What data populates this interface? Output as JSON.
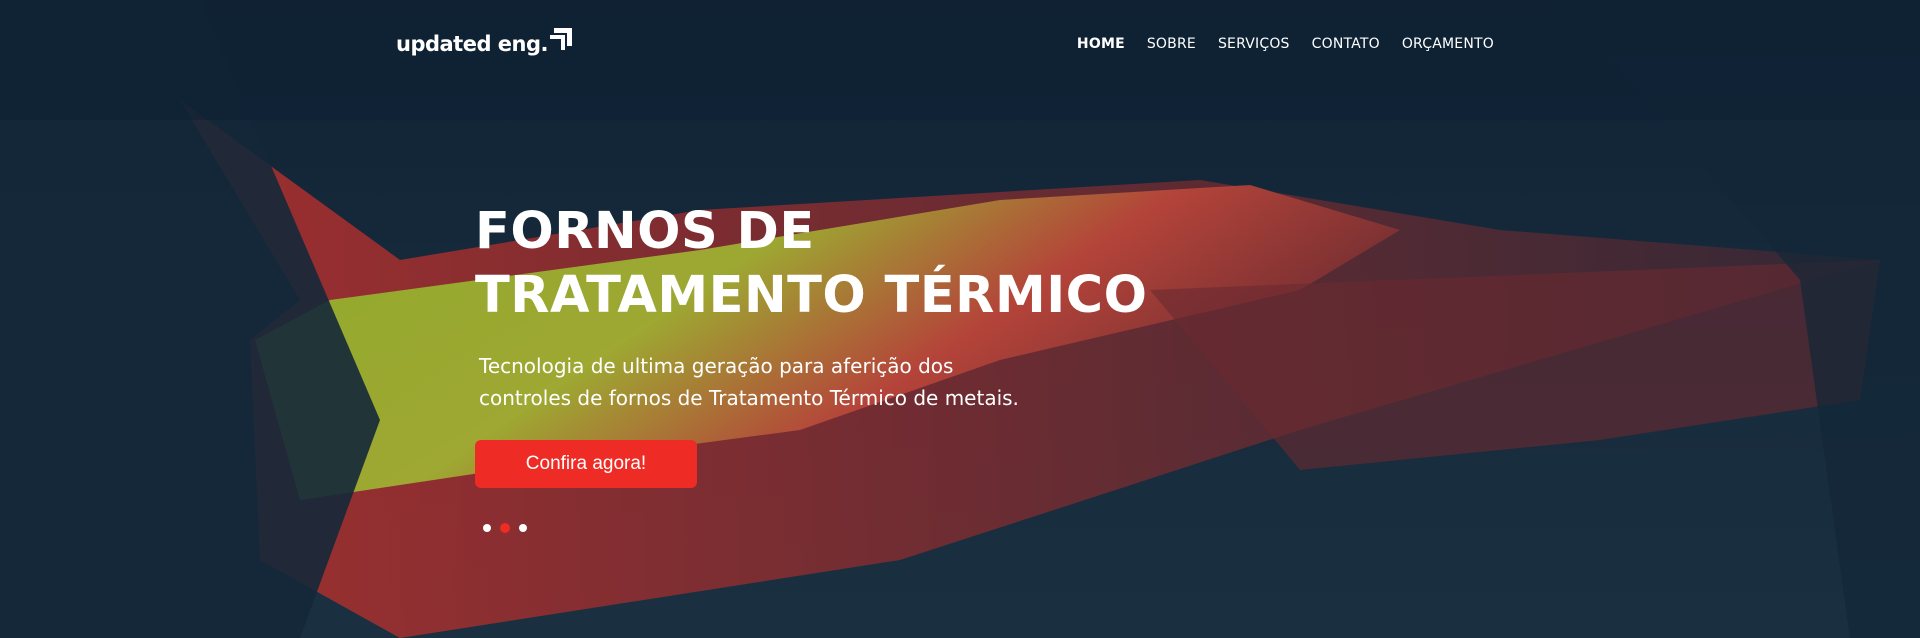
{
  "logo": {
    "text": "updated eng."
  },
  "nav": [
    {
      "label": "HOME",
      "active": true
    },
    {
      "label": "SOBRE"
    },
    {
      "label": "SERVIÇOS"
    },
    {
      "label": "CONTATO"
    },
    {
      "label": "ORÇAMENTO"
    }
  ],
  "hero": {
    "title_line1": "FORNOS DE",
    "title_line2": "TRATAMENTO TÉRMICO",
    "subtitle_line1": "Tecnologia de ultima geração para aferição dos",
    "subtitle_line2": "controles de fornos de Tratamento Térmico de metais.",
    "cta": "Confira agora!",
    "slides": 3,
    "active_slide": 2
  },
  "colors": {
    "accent": "#ee2b24",
    "overlay": "#13263a"
  }
}
